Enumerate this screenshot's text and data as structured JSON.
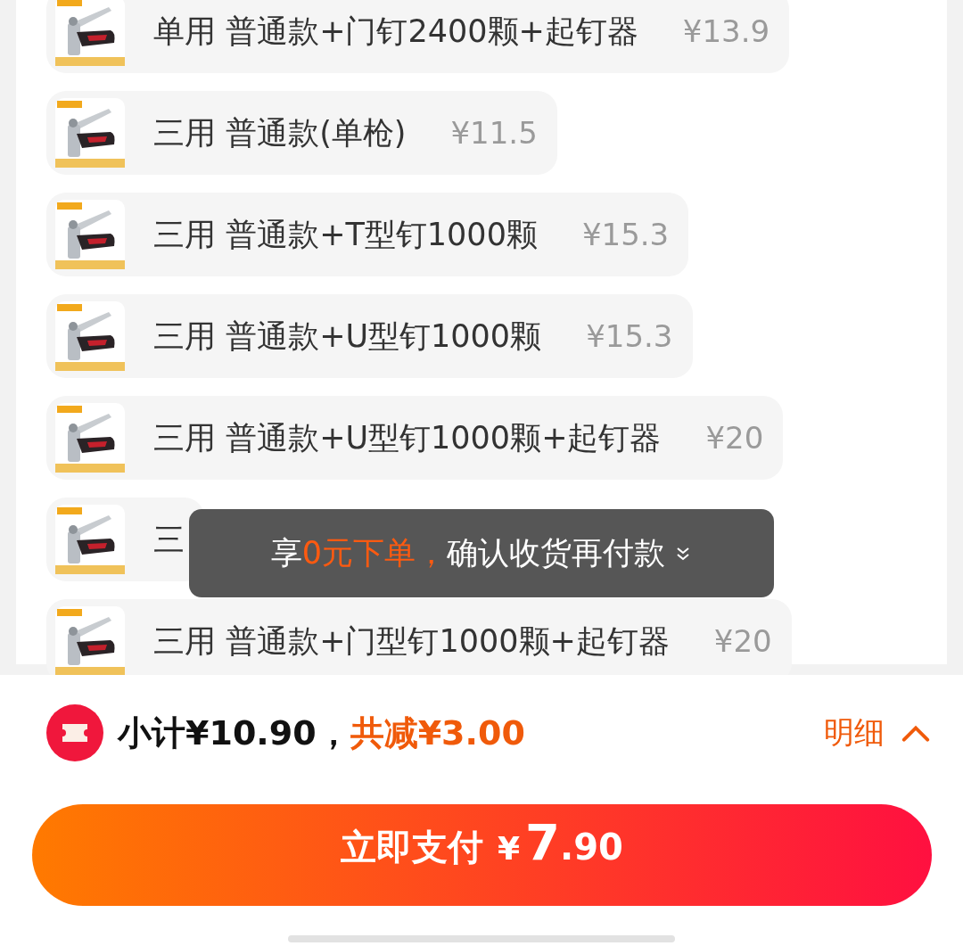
{
  "options": [
    {
      "label": "单用 普通款+门钉2400颗+起钉器",
      "price": "¥13.9"
    },
    {
      "label": "三用 普通款(单枪)",
      "price": "¥11.5"
    },
    {
      "label": "三用 普通款+T型钉1000颗",
      "price": "¥15.3"
    },
    {
      "label": "三用 普通款+U型钉1000颗",
      "price": "¥15.3"
    },
    {
      "label": "三用 普通款+U型钉1000颗+起钉器",
      "price": "¥20"
    },
    {
      "label": "三"
    },
    {
      "label": "三用 普通款+门型钉1000颗+起钉器",
      "price": "¥20"
    }
  ],
  "toast": {
    "segments": [
      {
        "text": "享",
        "highlight": false
      },
      {
        "text": "0元下单，",
        "highlight": true
      },
      {
        "text": "确认收货再付款",
        "highlight": false
      }
    ]
  },
  "summary": {
    "subtotal": "小计¥10.90，",
    "discount": "共减¥3.00",
    "details": "明细"
  },
  "pay_button": {
    "label": "立即支付",
    "currency": "¥",
    "integer": "7",
    "decimal": ".90"
  }
}
